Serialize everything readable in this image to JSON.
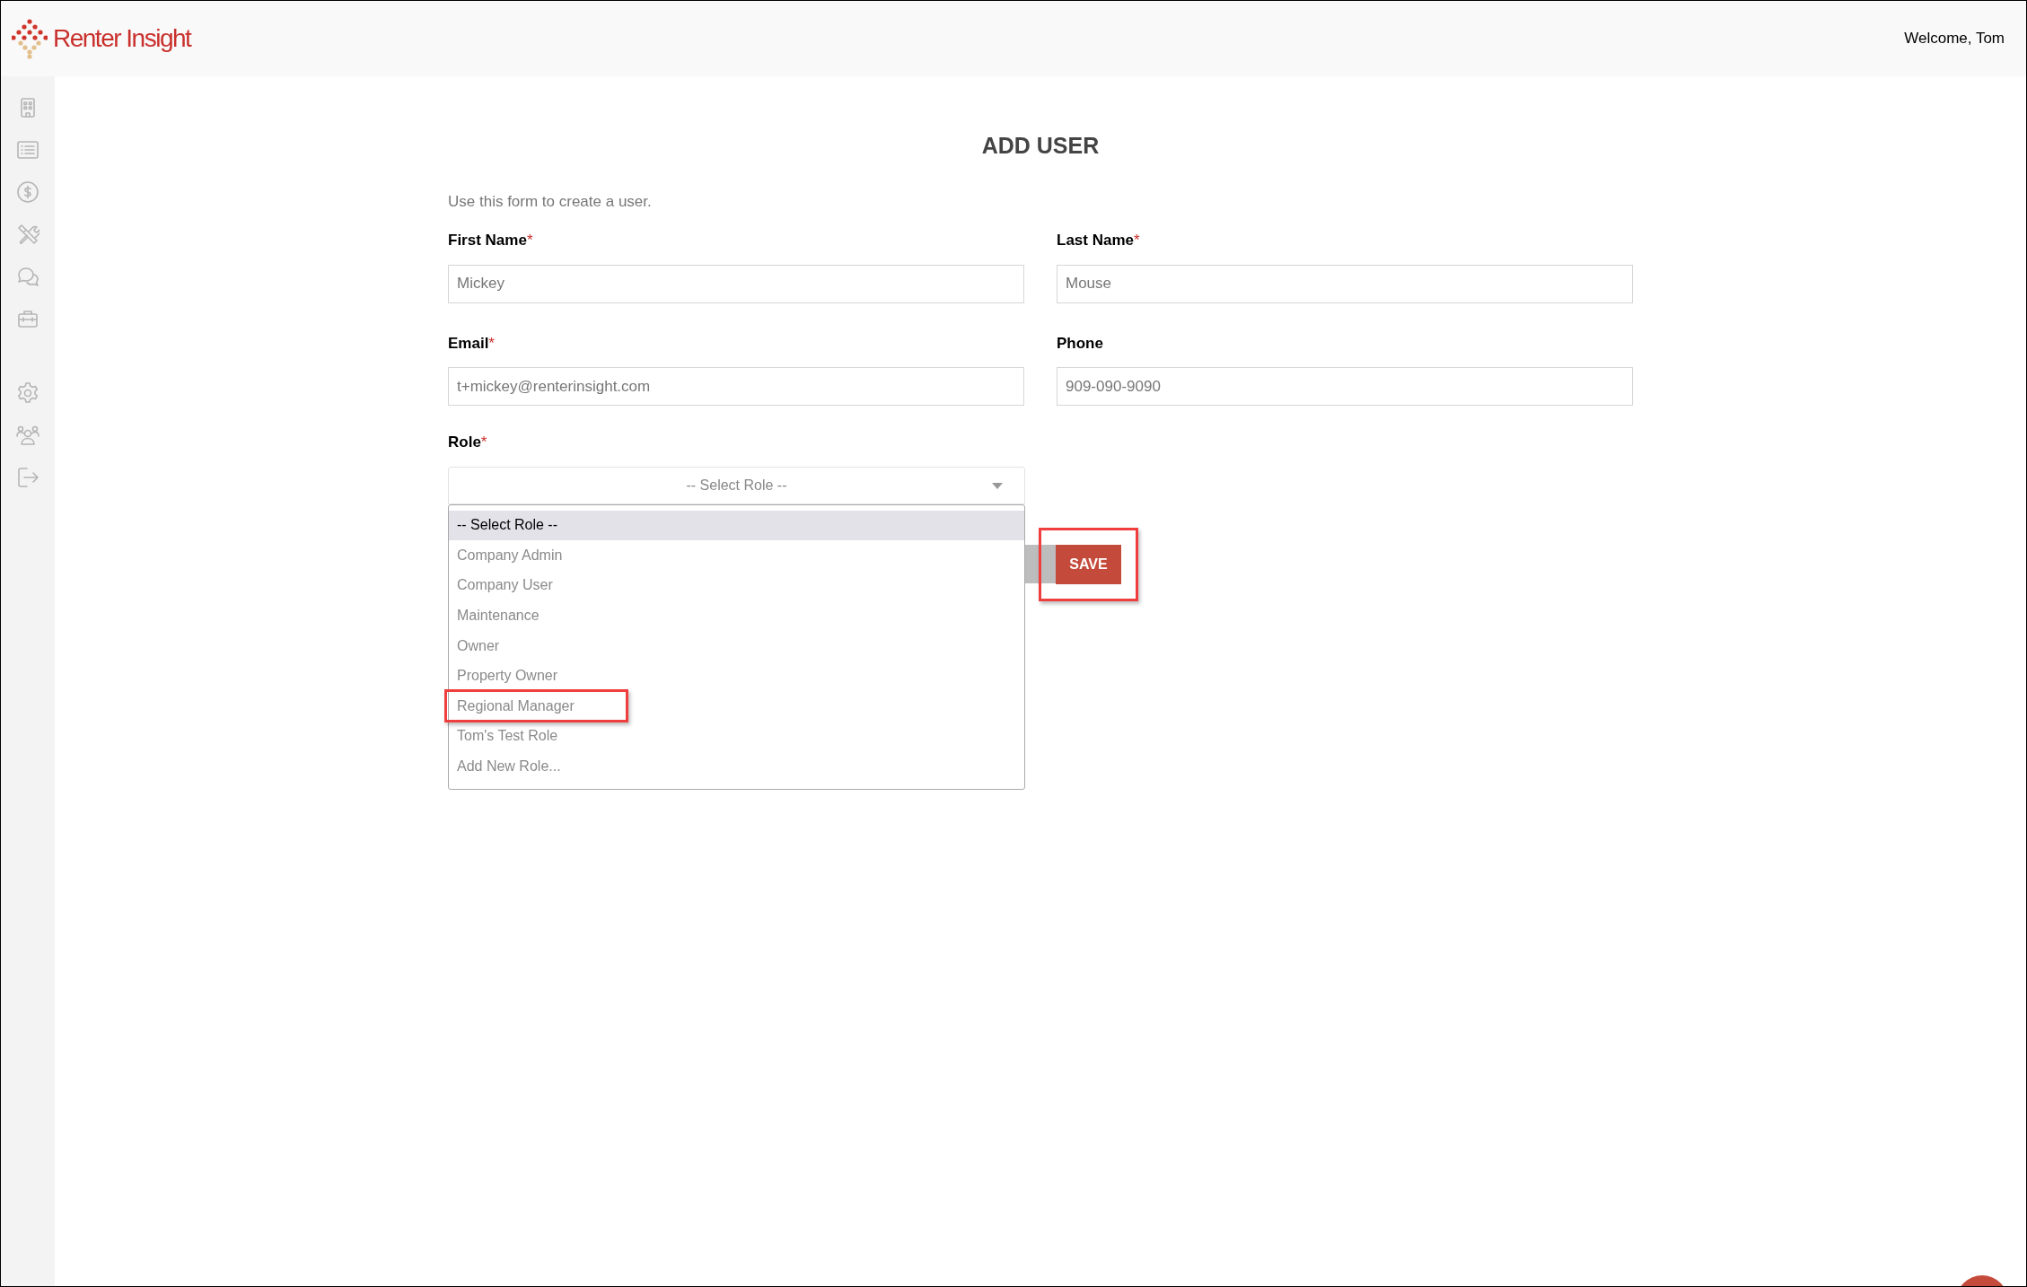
{
  "header": {
    "brand": "Renter Insight",
    "welcome": "Welcome, Tom"
  },
  "form": {
    "title": "ADD USER",
    "intro": "Use this form to create a user.",
    "fields": [
      {
        "label": "First Name",
        "required_mark": "*",
        "value": "Mickey"
      },
      {
        "label": "Last Name",
        "required_mark": "*",
        "value": "Mouse"
      },
      {
        "label": "Email",
        "required_mark": "*",
        "value": "t+mickey@renterinsight.com"
      },
      {
        "label": "Phone",
        "value": "909-090-9090"
      }
    ],
    "role": {
      "label": "Role",
      "required_mark": "*",
      "value": "-- Select Role --",
      "expanded": true,
      "options": [
        {
          "label": "-- Select Role --",
          "selected": true,
          "highlighted": false
        },
        {
          "label": "Company Admin",
          "selected": false,
          "highlighted": false
        },
        {
          "label": "Company User",
          "selected": false,
          "highlighted": false
        },
        {
          "label": "Maintenance",
          "selected": false,
          "highlighted": false
        },
        {
          "label": "Owner",
          "selected": false,
          "highlighted": false
        },
        {
          "label": "Property Owner",
          "selected": false,
          "highlighted": false
        },
        {
          "label": "Regional Manager",
          "selected": false,
          "highlighted": true
        },
        {
          "label": "Tom's Test Role",
          "selected": false,
          "highlighted": false
        },
        {
          "label": "Add New Role...",
          "selected": false,
          "highlighted": false
        }
      ]
    },
    "save": {
      "label": "SAVE",
      "highlighted": true
    }
  }
}
